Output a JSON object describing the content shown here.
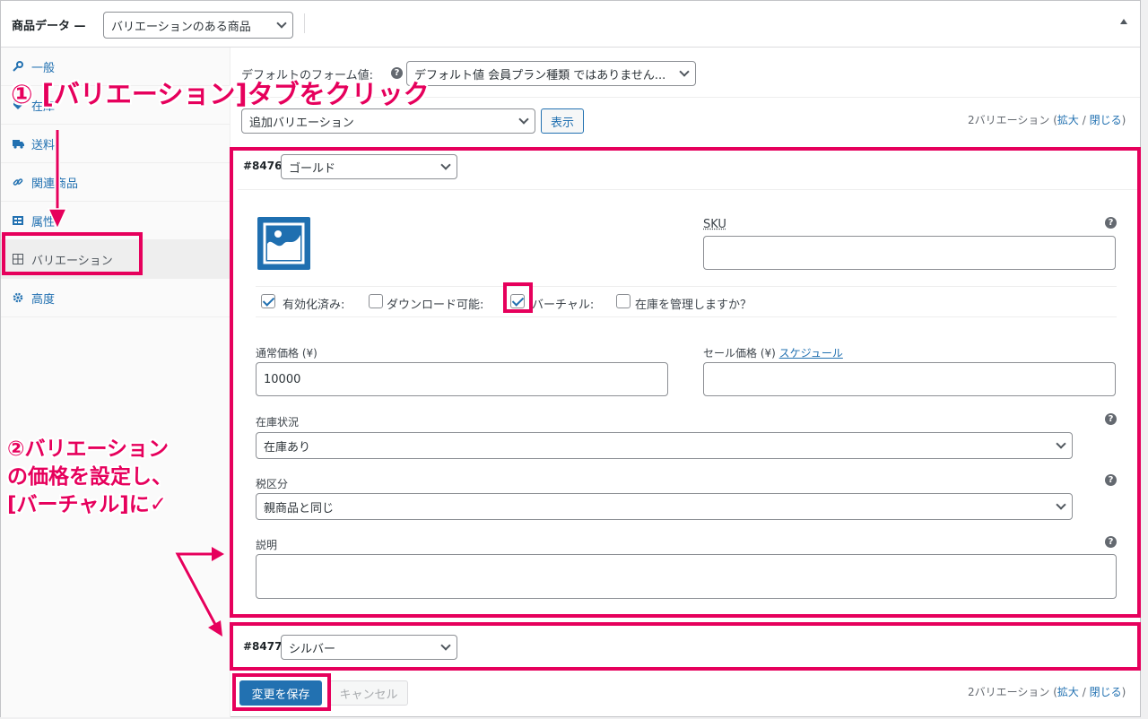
{
  "header": {
    "title": "商品データ —",
    "product_type": "バリエーションのある商品"
  },
  "tabs": [
    {
      "label": "一般",
      "icon": "wrench-icon"
    },
    {
      "label": "在庫",
      "icon": "tag-icon"
    },
    {
      "label": "送料",
      "icon": "truck-icon"
    },
    {
      "label": "関連商品",
      "icon": "link-icon"
    },
    {
      "label": "属性",
      "icon": "list-icon"
    },
    {
      "label": "バリエーション",
      "icon": "grid-icon"
    },
    {
      "label": "高度",
      "icon": "gear-icon"
    }
  ],
  "defaults": {
    "label": "デフォルトのフォーム値:",
    "value": "デフォルト値 会員プラン種類 ではありません..."
  },
  "toolbar": {
    "action_select": "追加バリエーション",
    "go_button": "表示",
    "count": "2バリエーション",
    "expand": "拡大",
    "sep": "/",
    "close": "閉じる",
    "paren_open": "(",
    "paren_close": ")"
  },
  "variation1": {
    "id": "#8476",
    "attribute": "ゴールド",
    "sku_label": "SKU",
    "enabled_label": "有効化済み:",
    "download_label": "ダウンロード可能:",
    "virtual_label": "バーチャル:",
    "manage_stock_label": "在庫を管理しますか？",
    "regular_price_label": "通常価格 (¥)",
    "regular_price_value": "10000",
    "sale_price_label": "セール価格 (¥)",
    "schedule_link": "スケジュール",
    "stock_status_label": "在庫状況",
    "stock_status_value": "在庫あり",
    "tax_class_label": "税区分",
    "tax_class_value": "親商品と同じ",
    "description_label": "説明",
    "enabled": true,
    "downloadable": false,
    "virtual": true,
    "manage_stock": false
  },
  "variation2": {
    "id": "#8477",
    "attribute": "シルバー"
  },
  "footer": {
    "save_button": "変更を保存",
    "cancel_button": "キャンセル"
  },
  "annotations": {
    "step1": "① [バリエーション]タブをクリック",
    "step2_line1": "②バリエーション",
    "step2_line2": "の価格を設定し、",
    "step2_line3": "[バーチャル]に✓",
    "color": "#e6005c"
  },
  "help_glyph": "?"
}
